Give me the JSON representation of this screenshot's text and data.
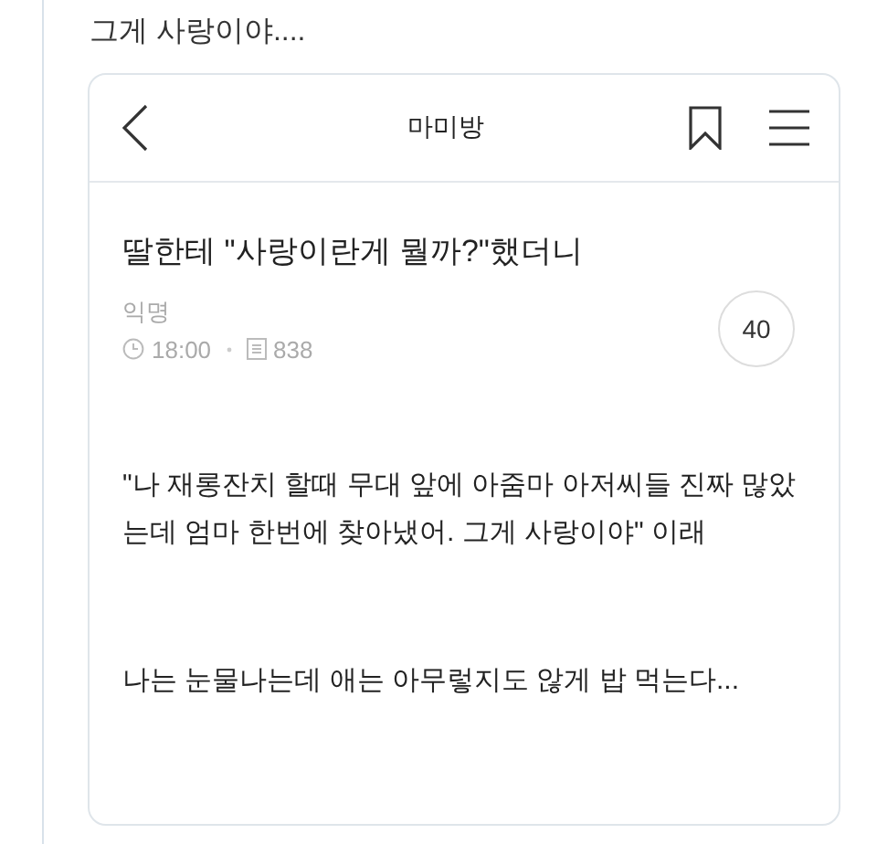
{
  "caption": "그게 사랑이야....",
  "header": {
    "title": "마미방"
  },
  "post": {
    "title": "딸한테 \"사랑이란게 뭘까?\"했더니",
    "author": "익명",
    "time": "18:00",
    "views": "838",
    "comment_count": "40"
  },
  "paragraphs": [
    "\"나 재롱잔치 할때 무대 앞에 아줌마 아저씨들 진짜 많았는데 엄마 한번에 찾아냈어. 그게 사랑이야\" 이래",
    "나는 눈물나는데 애는 아무렇지도 않게 밥 먹는다..."
  ]
}
